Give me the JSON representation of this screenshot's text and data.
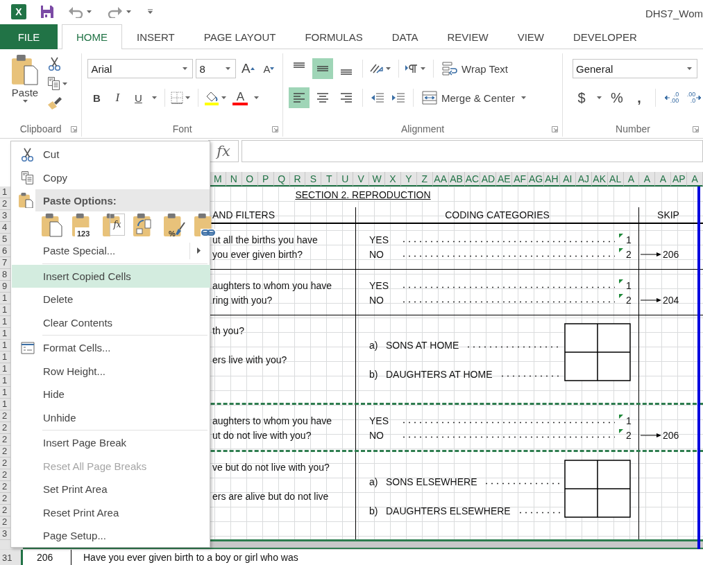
{
  "title_bar": {
    "app_letter": "X",
    "title": "DHS7_Wom"
  },
  "tabs": [
    {
      "label": "FILE",
      "kind": "file",
      "selected": false
    },
    {
      "label": "HOME",
      "kind": "tab",
      "selected": true
    },
    {
      "label": "INSERT",
      "kind": "tab",
      "selected": false
    },
    {
      "label": "PAGE LAYOUT",
      "kind": "tab",
      "selected": false
    },
    {
      "label": "FORMULAS",
      "kind": "tab",
      "selected": false
    },
    {
      "label": "DATA",
      "kind": "tab",
      "selected": false
    },
    {
      "label": "REVIEW",
      "kind": "tab",
      "selected": false
    },
    {
      "label": "VIEW",
      "kind": "tab",
      "selected": false
    },
    {
      "label": "DEVELOPER",
      "kind": "tab",
      "selected": false
    }
  ],
  "ribbon": {
    "clipboard": {
      "paste": "Paste",
      "label": "Clipboard"
    },
    "font": {
      "name": "Arial",
      "size": "8",
      "grow": "A",
      "shrink": "A",
      "bold": "B",
      "italic": "I",
      "underline": "U",
      "font_color": "A",
      "label": "Font"
    },
    "alignment": {
      "vertical_align": [
        {
          "kind": "top",
          "selected": false
        },
        {
          "kind": "middle",
          "selected": true
        },
        {
          "kind": "bottom",
          "selected": false
        }
      ],
      "horizontal_align": [
        {
          "kind": "left",
          "selected": true
        },
        {
          "kind": "center",
          "selected": false
        },
        {
          "kind": "right",
          "selected": false
        }
      ],
      "wrap_text": "Wrap Text",
      "merge": "Merge & Center",
      "label": "Alignment"
    },
    "number": {
      "format": "General",
      "currency": "$",
      "percent": "%",
      "comma": ",",
      "decimals": [
        {
          "kind": "increase",
          "top": ".0",
          "bottom": ".00"
        },
        {
          "kind": "decrease",
          "top": ".00",
          "bottom": ".0"
        }
      ],
      "label": "Number"
    }
  },
  "formula_bar": {
    "fx": "fx"
  },
  "column_headers": [
    "M",
    "N",
    "O",
    "P",
    "Q",
    "R",
    "S",
    "T",
    "U",
    "V",
    "W",
    "X",
    "Y",
    "Z",
    "AA",
    "AB",
    "AC",
    "AD",
    "AE",
    "AF",
    "AG",
    "AH",
    "AI",
    "AJ",
    "AK",
    "AL",
    "A",
    "A",
    "A",
    "AP",
    "A"
  ],
  "row_headers": [
    "1",
    "2",
    "3",
    "4",
    "5",
    "6",
    "7",
    "8",
    "9",
    "1",
    "1",
    "1",
    "1",
    "1",
    "1",
    "1",
    "1",
    "1",
    "1",
    "2",
    "2",
    "2",
    "2",
    "2",
    "2",
    "2",
    "2",
    "2",
    "2",
    "3"
  ],
  "form": {
    "section_title": "SECTION 2. REPRODUCTION",
    "header": {
      "question": "AND FILTERS",
      "coding": "CODING CATEGORIES",
      "skip": "SKIP"
    },
    "blocks": [
      {
        "kind": "yes_no",
        "question_lines": [
          "ut all the births you have",
          "you ever given birth?"
        ],
        "answers": [
          {
            "label": "YES",
            "code": "1"
          },
          {
            "label": "NO",
            "code": "2",
            "skip": "206"
          }
        ]
      },
      {
        "kind": "rule"
      },
      {
        "kind": "yes_no",
        "question_lines": [
          "aughters to whom you have",
          "ring with you?"
        ],
        "answers": [
          {
            "label": "YES",
            "code": "1"
          },
          {
            "label": "NO",
            "code": "2",
            "skip": "204"
          }
        ]
      },
      {
        "kind": "rule"
      },
      {
        "kind": "count",
        "question_lines": [
          "th you?",
          "ers live with you?"
        ],
        "answers": [
          {
            "letter": "a)",
            "label": "SONS AT HOME"
          },
          {
            "letter": "b)",
            "label": "DAUGHTERS AT HOME"
          }
        ]
      },
      {
        "kind": "dashed_rule"
      },
      {
        "kind": "yes_no",
        "question_lines": [
          "aughters to whom you have",
          "ut do not live with you?"
        ],
        "answers": [
          {
            "label": "YES",
            "code": "1"
          },
          {
            "label": "NO",
            "code": "2",
            "skip": "206"
          }
        ]
      },
      {
        "kind": "dashed_rule"
      },
      {
        "kind": "count",
        "question_lines": [
          "ve but do not live with you?",
          "ers are alive but do not live"
        ],
        "answers": [
          {
            "letter": "a)",
            "label": "SONS ELSEWHERE"
          },
          {
            "letter": "b)",
            "label": "DAUGHTERS ELSEWHERE"
          }
        ]
      },
      {
        "kind": "page_break"
      }
    ]
  },
  "last_row": {
    "row_number": "31",
    "number": "206",
    "question": "Have you ever given birth to a boy or girl who was"
  },
  "context_menu": {
    "items": [
      {
        "kind": "cut",
        "label": "Cut",
        "selected": false,
        "disabled": false
      },
      {
        "kind": "copy",
        "label": "Copy",
        "selected": false,
        "disabled": false
      },
      {
        "kind": "paste_header",
        "label": "Paste Options:"
      },
      {
        "kind": "paste_icons",
        "options": [
          {
            "kind": "paste"
          },
          {
            "kind": "values",
            "caption": "123"
          },
          {
            "kind": "formulas",
            "caption": "fx"
          },
          {
            "kind": "transpose"
          },
          {
            "kind": "formatting",
            "caption": "%"
          },
          {
            "kind": "link"
          }
        ]
      },
      {
        "kind": "submenu",
        "label": "Paste Special...",
        "selected": false,
        "disabled": false
      },
      {
        "kind": "separator"
      },
      {
        "kind": "plain",
        "label": "Insert Copied Cells",
        "selected": true,
        "disabled": false
      },
      {
        "kind": "plain",
        "label": "Delete",
        "selected": false,
        "disabled": false
      },
      {
        "kind": "plain",
        "label": "Clear Contents",
        "selected": false,
        "disabled": false
      },
      {
        "kind": "separator"
      },
      {
        "kind": "format",
        "label": "Format Cells...",
        "selected": false,
        "disabled": false
      },
      {
        "kind": "plain",
        "label": "Row Height...",
        "selected": false,
        "disabled": false
      },
      {
        "kind": "plain",
        "label": "Hide",
        "selected": false,
        "disabled": false
      },
      {
        "kind": "plain",
        "label": "Unhide",
        "selected": false,
        "disabled": false
      },
      {
        "kind": "separator"
      },
      {
        "kind": "plain",
        "label": "Insert Page Break",
        "selected": false,
        "disabled": false
      },
      {
        "kind": "plain",
        "label": "Reset All Page Breaks",
        "selected": false,
        "disabled": true
      },
      {
        "kind": "plain",
        "label": "Set Print Area",
        "selected": false,
        "disabled": false
      },
      {
        "kind": "plain",
        "label": "Reset Print Area",
        "selected": false,
        "disabled": false
      },
      {
        "kind": "plain",
        "label": "Page Setup...",
        "selected": false,
        "disabled": false
      }
    ]
  }
}
